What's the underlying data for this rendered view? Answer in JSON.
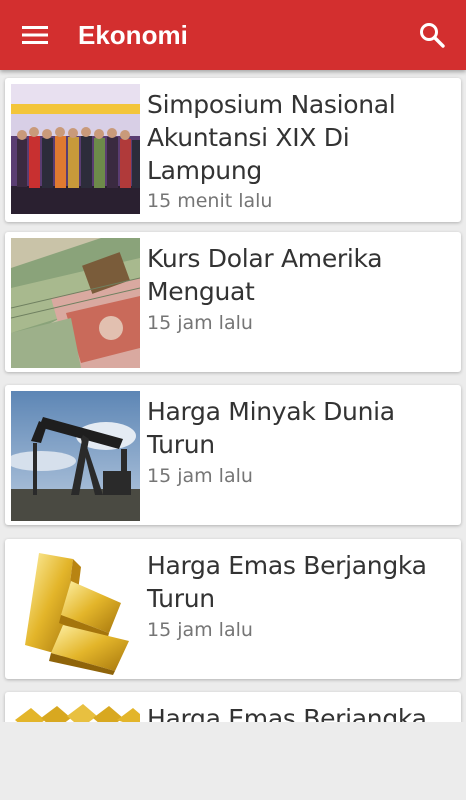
{
  "appbar": {
    "title": "Ekonomi",
    "color": "#d32f2f",
    "menu_icon": "hamburger-menu-icon",
    "search_icon": "search-icon"
  },
  "articles": [
    {
      "headline": "Simposium Nasional Akuntansi XIX Di Lampung",
      "time": "15 menit lalu",
      "image": "group-photo-stage"
    },
    {
      "headline": "Kurs Dolar Amerika Menguat",
      "time": "15 jam lalu",
      "image": "dollar-rupiah-banknotes"
    },
    {
      "headline": "Harga Minyak Dunia Turun",
      "time": "15 jam lalu",
      "image": "oil-pump-jack"
    },
    {
      "headline": "Harga Emas Berjangka Turun",
      "time": "15 jam lalu",
      "image": "gold-bars"
    },
    {
      "headline": "Harga Emas Berjangka",
      "time": "",
      "image": "gold-bars"
    }
  ]
}
